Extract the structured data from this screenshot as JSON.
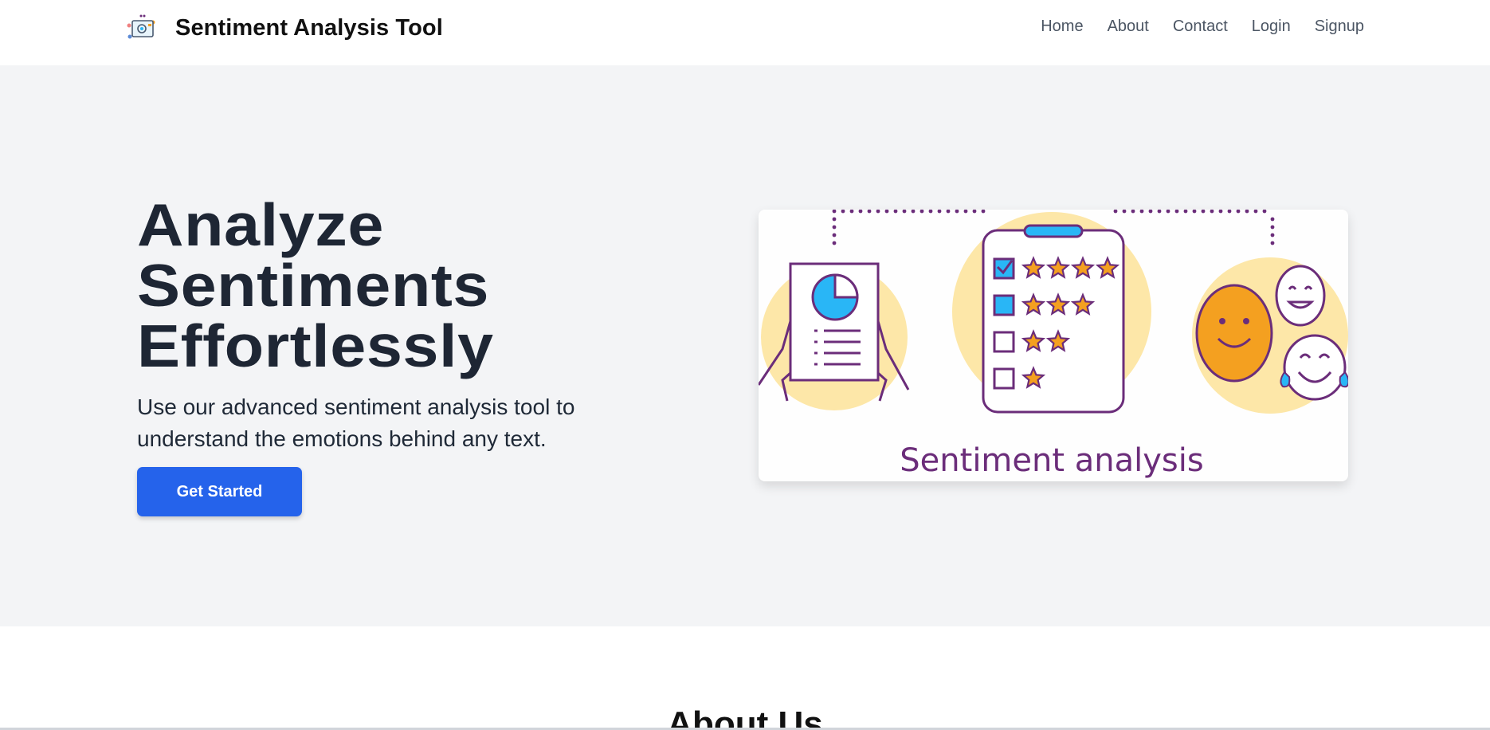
{
  "nav": {
    "brand_title": "Sentiment Analysis Tool",
    "links": [
      "Home",
      "About",
      "Contact",
      "Login",
      "Signup"
    ]
  },
  "hero": {
    "title_lines": [
      "Analyze",
      "Sentiments",
      "Effortlessly"
    ],
    "subtitle": "Use our advanced sentiment analysis tool to understand the emotions behind any text.",
    "cta_label": "Get Started",
    "image_caption": "Sentiment analysis"
  },
  "about": {
    "title": "About Us"
  },
  "colors": {
    "primary": "#2563eb",
    "hero_bg": "#f3f4f6",
    "illustration_purple": "#6b2d7a",
    "illustration_blue": "#29b6f6",
    "illustration_orange": "#f4a020",
    "illustration_yellow": "#fde7a8"
  },
  "icons": {
    "brand": "sentiment-logo-icon"
  }
}
